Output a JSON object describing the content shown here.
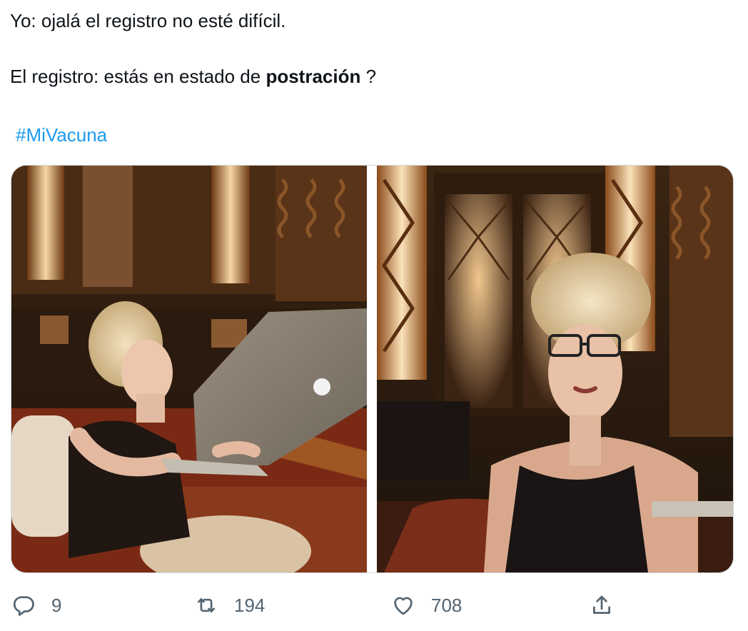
{
  "tweet": {
    "line1": "Yo: ojalá el registro no esté difícil.",
    "line2_prefix": "El registro: estás en estado de ",
    "line2_bold": "postración",
    "line2_suffix": " ?",
    "hashtag": "#MiVacuna"
  },
  "media": {
    "photos": [
      {
        "subject": "Woman with blonde pompadour hair using a silver laptop in an art-deco room"
      },
      {
        "subject": "Woman with blonde pompadour hair and glasses looking at the camera in an art-deco room"
      }
    ]
  },
  "actions": {
    "reply": {
      "icon": "reply-icon",
      "count": "9"
    },
    "retweet": {
      "icon": "retweet-icon",
      "count": "194"
    },
    "like": {
      "icon": "heart-icon",
      "count": "708"
    },
    "share": {
      "icon": "share-icon"
    }
  },
  "colors": {
    "text": "#0f1419",
    "link": "#1d9bf0",
    "muted": "#536471",
    "border": "#cfd9de"
  }
}
